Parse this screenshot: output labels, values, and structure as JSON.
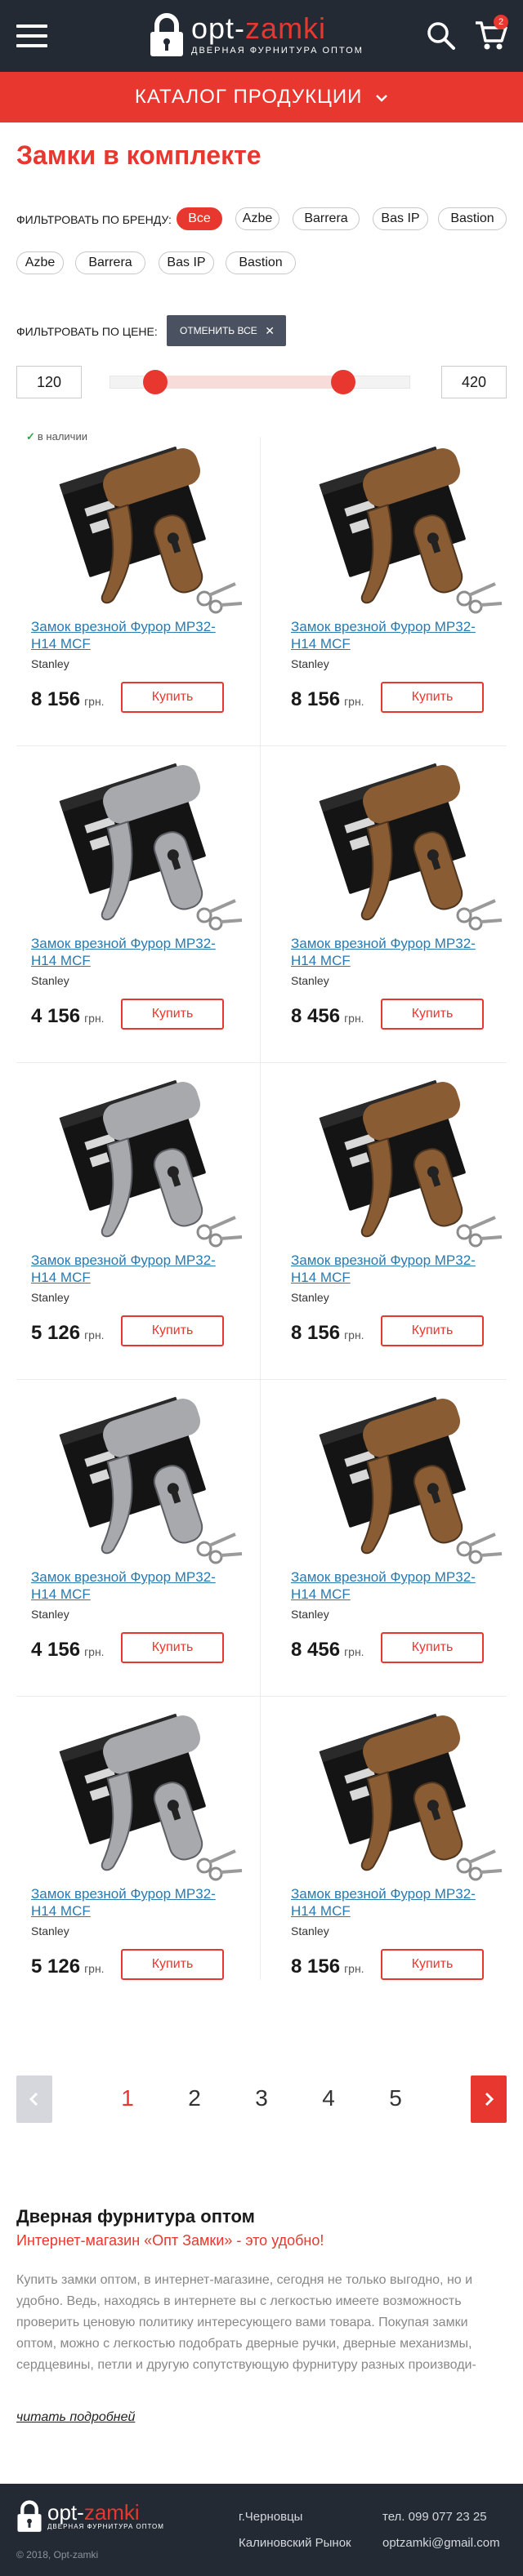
{
  "header": {
    "logo": {
      "name_start": "opt-",
      "name_end": "zamki",
      "tagline": "ДВЕРНАЯ ФУРНИТУРА ОПТОМ"
    },
    "cart_count": "2"
  },
  "catalog_bar": {
    "label": "КАТАЛОГ ПРОДУКЦИИ"
  },
  "page_title": "Замки в комплекте",
  "filter_brand": {
    "label": "ФИЛЬТРОВАТЬ ПО БРЕНДУ:",
    "options": [
      "Все",
      "Azbe",
      "Barrera",
      "Bas IP",
      "Bastion",
      "Azbe",
      "Barrera",
      "Bas IP",
      "Bastion"
    ],
    "active_index": 0
  },
  "filter_price": {
    "label": "ФИЛЬТРОВАТЬ ПО ЦЕНЕ:",
    "reset_label": "ОТМЕНИТЬ ВСЕ",
    "min": "120",
    "max": "420"
  },
  "products": [
    {
      "name": "Замок врезной Фурор МР32-Н14 MCF",
      "brand": "Stanley",
      "price": "8 156",
      "currency": "грн.",
      "buy_label": "Купить",
      "in_stock": "в наличии",
      "finish": "bronze"
    },
    {
      "name": "Замок врезной Фурор МР32-Н14 MCF",
      "brand": "Stanley",
      "price": "8 156",
      "currency": "грн.",
      "buy_label": "Купить",
      "finish": "bronze"
    },
    {
      "name": "Замок врезной Фурор МР32-Н14 MCF",
      "brand": "Stanley",
      "price": "4 156",
      "currency": "грн.",
      "buy_label": "Купить",
      "finish": "chrome"
    },
    {
      "name": "Замок врезной Фурор МР32-Н14 MCF",
      "brand": "Stanley",
      "price": "8 456",
      "currency": "грн.",
      "buy_label": "Купить",
      "finish": "bronze"
    },
    {
      "name": "Замок врезной Фурор МР32-Н14 MCF",
      "brand": "Stanley",
      "price": "5 126",
      "currency": "грн.",
      "buy_label": "Купить",
      "finish": "chrome"
    },
    {
      "name": "Замок врезной Фурор МР32-Н14 MCF",
      "brand": "Stanley",
      "price": "8 156",
      "currency": "грн.",
      "buy_label": "Купить",
      "finish": "bronze"
    },
    {
      "name": "Замок врезной Фурор МР32-Н14 MCF",
      "brand": "Stanley",
      "price": "4 156",
      "currency": "грн.",
      "buy_label": "Купить",
      "finish": "chrome"
    },
    {
      "name": "Замок врезной Фурор МР32-Н14 MCF",
      "brand": "Stanley",
      "price": "8 456",
      "currency": "грн.",
      "buy_label": "Купить",
      "finish": "bronze"
    },
    {
      "name": "Замок врезной Фурор МР32-Н14 MCF",
      "brand": "Stanley",
      "price": "5 126",
      "currency": "грн.",
      "buy_label": "Купить",
      "finish": "chrome"
    },
    {
      "name": "Замок врезной Фурор МР32-Н14 MCF",
      "brand": "Stanley",
      "price": "8 156",
      "currency": "грн.",
      "buy_label": "Купить",
      "finish": "bronze"
    }
  ],
  "pagination": {
    "pages": [
      "1",
      "2",
      "3",
      "4",
      "5"
    ],
    "current": "1"
  },
  "seo": {
    "title": "Дверная фурнитура оптом",
    "subtitle": "Интернет-магазин «Опт Замки» - это удобно!",
    "text": "Купить замки оптом, в интернет-магазине, сегодня не только выгодно, но и удобно. Ведь, находясь в интернете вы с легкостью имеете возможность проверить ценовую политику интересующего вами товара. Покупая замки оптом, можно с легкостью подобрать дверные ручки, дверные механизмы, сердцевины, петли и другую сопутствующую фурнитуру разных производи-",
    "more_label": "читать подробней"
  },
  "footer": {
    "logo": {
      "name_start": "opt-",
      "name_end": "zamki",
      "tagline": "ДВЕРНАЯ ФУРНИТУРА ОПТОМ"
    },
    "copyright": "© 2018, Opt-zamki",
    "city": "г.Черновцы",
    "address": "Калиновский Рынок",
    "phone": "тел. 099 077 23 25",
    "email": "optzamki@gmail.com"
  },
  "icons": {
    "menu": "hamburger-menu-icon",
    "logo": "padlock-icon",
    "search": "search-icon",
    "cart": "cart-icon",
    "catalog_toggle": "chevron-down-icon",
    "reset": "close-icon",
    "in_stock": "checkmark-icon",
    "prev": "chevron-left-icon",
    "next": "chevron-right-icon"
  },
  "colors": {
    "accent": "#e8372f",
    "header_bg": "#232a33",
    "link": "#2a7ab0",
    "reset_bg": "#4a5161",
    "bronze": "#8a5c33",
    "chrome": "#a7a9ad"
  }
}
